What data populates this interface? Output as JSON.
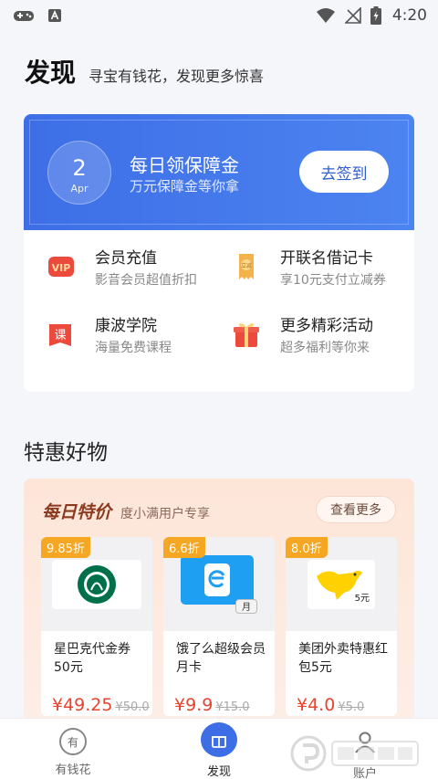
{
  "status_bar": {
    "time": "4:20"
  },
  "header": {
    "title": "发现",
    "subtitle": "寻宝有钱花，发现更多惊喜"
  },
  "banner": {
    "day": "2",
    "month": "Apr",
    "title": "每日领保障金",
    "subtitle": "万元保障金等你拿",
    "button": "去签到"
  },
  "features": [
    {
      "name": "会员充值",
      "desc": "影音会员超值折扣",
      "icon": "vip-icon"
    },
    {
      "name": "开联名借记卡",
      "desc": "享10元支付立减券",
      "icon": "card-coupon-icon"
    },
    {
      "name": "康波学院",
      "desc": "海量免费课程",
      "icon": "course-icon"
    },
    {
      "name": "更多精彩活动",
      "desc": "超多福利等你来",
      "icon": "gift-icon"
    }
  ],
  "section_title": "特惠好物",
  "deals": {
    "title": "每日特价",
    "subtitle": "度小满用户专享",
    "more": "查看更多",
    "products": [
      {
        "tag": "9.85折",
        "name": "星巴克代金券50元",
        "price": "¥49.25",
        "original": "¥50.0",
        "icon": "starbucks-logo"
      },
      {
        "tag": "6.6折",
        "name": "饿了么超级会员月卡",
        "price": "¥9.9",
        "original": "¥15.0",
        "icon": "eleme-logo",
        "thumb_label": "月"
      },
      {
        "tag": "8.0折",
        "name": "美团外卖特惠红包5元",
        "price": "¥4.0",
        "original": "¥5.0",
        "icon": "meituan-logo",
        "thumb_label": "5元"
      }
    ]
  },
  "bottom_nav": [
    {
      "label": "有钱花",
      "icon_text": "有",
      "active": false
    },
    {
      "label": "发现",
      "active": true
    },
    {
      "label": "账户",
      "active": false
    }
  ]
}
